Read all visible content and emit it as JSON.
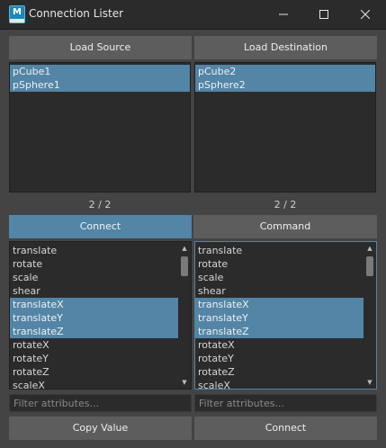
{
  "window": {
    "title": "Connection Lister",
    "icon_letter": "M",
    "controls": [
      "minimize-icon",
      "maximize-icon",
      "close-icon"
    ]
  },
  "top_buttons": {
    "load_source": "Load Source",
    "load_destination": "Load Destination"
  },
  "source_list": {
    "items": [
      "pCube1",
      "pSphere1"
    ],
    "count": "2 / 2"
  },
  "destination_list": {
    "items": [
      "pCube2",
      "pSphere2"
    ],
    "count": "2 / 2"
  },
  "tabs": {
    "connect": "Connect",
    "command": "Command",
    "active": "connect"
  },
  "source_attrs": [
    "translate",
    "rotate",
    "scale",
    "shear",
    "translateX",
    "translateY",
    "translateZ",
    "rotateX",
    "rotateY",
    "rotateZ",
    "scaleX"
  ],
  "source_selected": [
    "translateX",
    "translateY",
    "translateZ"
  ],
  "destination_attrs": [
    "translate",
    "rotate",
    "scale",
    "shear",
    "translateX",
    "translateY",
    "translateZ",
    "rotateX",
    "rotateY",
    "rotateZ",
    "scaleX"
  ],
  "destination_selected": [
    "translateX",
    "translateY",
    "translateZ"
  ],
  "filters": {
    "source_placeholder": "Filter attributes...",
    "destination_placeholder": "Filter attributes..."
  },
  "bottom_buttons": {
    "copy_value": "Copy Value",
    "connect": "Connect"
  },
  "colors": {
    "background": "#444444",
    "selection": "#5285a6",
    "button": "#5d5d5d",
    "list_bg": "#2b2b2b"
  }
}
